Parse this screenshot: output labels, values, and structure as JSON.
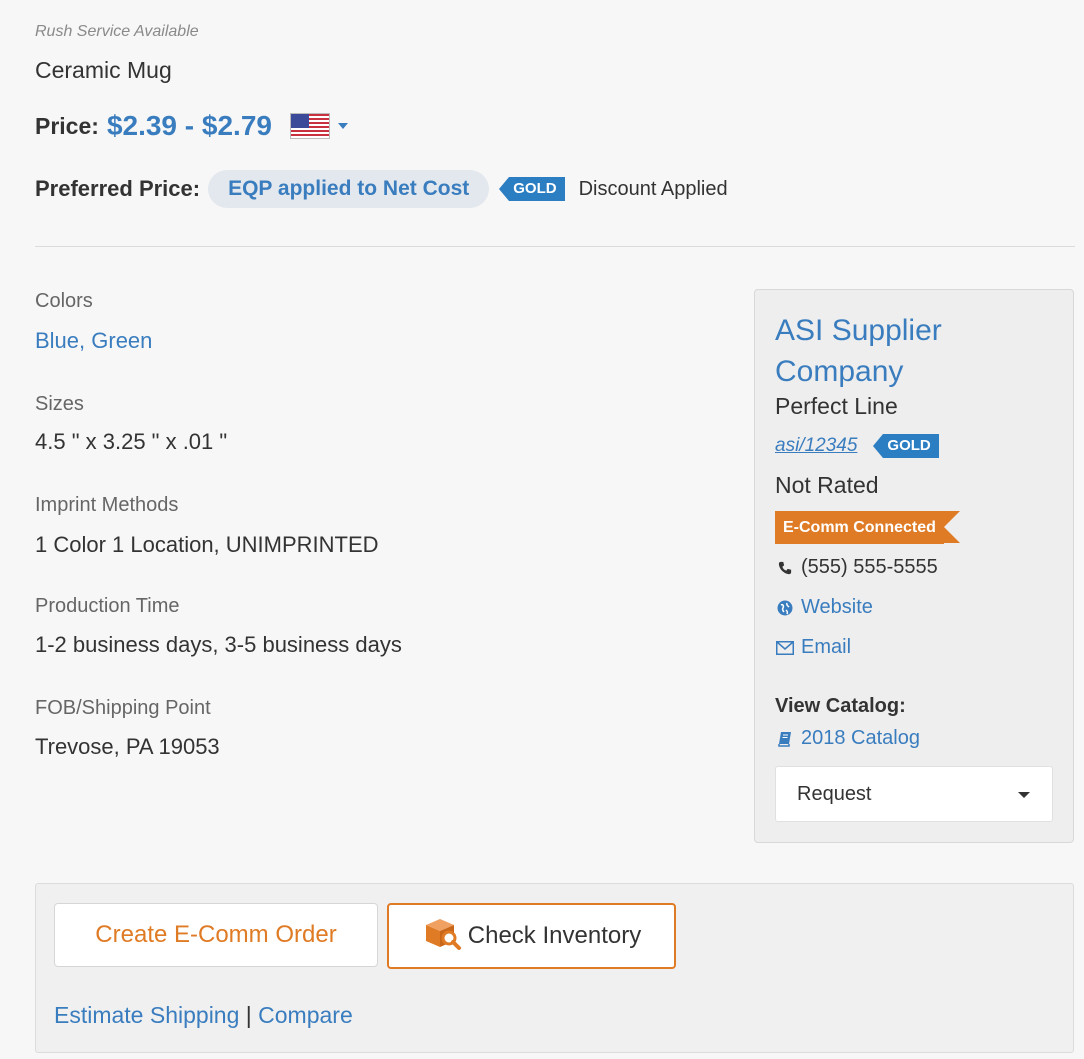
{
  "product": {
    "rush_note": "Rush Service Available",
    "name": "Ceramic Mug",
    "price_label": "Price:",
    "price_value": "$2.39 - $2.79",
    "preferred_label": "Preferred Price:",
    "preferred_pill": "EQP applied to Net Cost",
    "gold_badge": "GOLD",
    "discount_text": "Discount Applied"
  },
  "specs": [
    {
      "label": "Colors",
      "value": "Blue, Green",
      "is_link": true
    },
    {
      "label": "Sizes",
      "value": "4.5 \" x 3.25 \" x .01 \"",
      "is_link": false
    },
    {
      "label": "Imprint Methods",
      "value": "1 Color 1 Location, UNIMPRINTED",
      "is_link": false
    },
    {
      "label": "Production Time",
      "value": "1-2 business days, 3-5 business days",
      "is_link": false
    },
    {
      "label": "FOB/Shipping Point",
      "value": "Trevose, PA 19053",
      "is_link": false
    }
  ],
  "supplier": {
    "name": "ASI Supplier Company",
    "line": "Perfect Line",
    "asi_number": "asi/12345",
    "gold_badge": "GOLD",
    "rating": "Not Rated",
    "ecomm_badge": "E-Comm Connected",
    "phone": "(555) 555-5555",
    "website_label": "Website",
    "email_label": "Email",
    "view_catalog_label": "View Catalog:",
    "catalog_link": "2018 Catalog",
    "request_select": "Request"
  },
  "actions": {
    "create_order": "Create E-Comm Order",
    "check_inventory": "Check Inventory",
    "estimate_shipping": "Estimate Shipping",
    "separator": "|",
    "compare": "Compare"
  },
  "colors": {
    "link": "#3a7dbf",
    "accent_orange": "#e07b25",
    "gold_badge_bg": "#2b7ec2",
    "pill_bg": "#e3e8ee"
  },
  "icons": {
    "flag": "us-flag-icon",
    "phone": "phone-icon",
    "website": "globe-icon",
    "email": "envelope-icon",
    "catalog": "book-icon",
    "inventory": "box-search-icon"
  }
}
